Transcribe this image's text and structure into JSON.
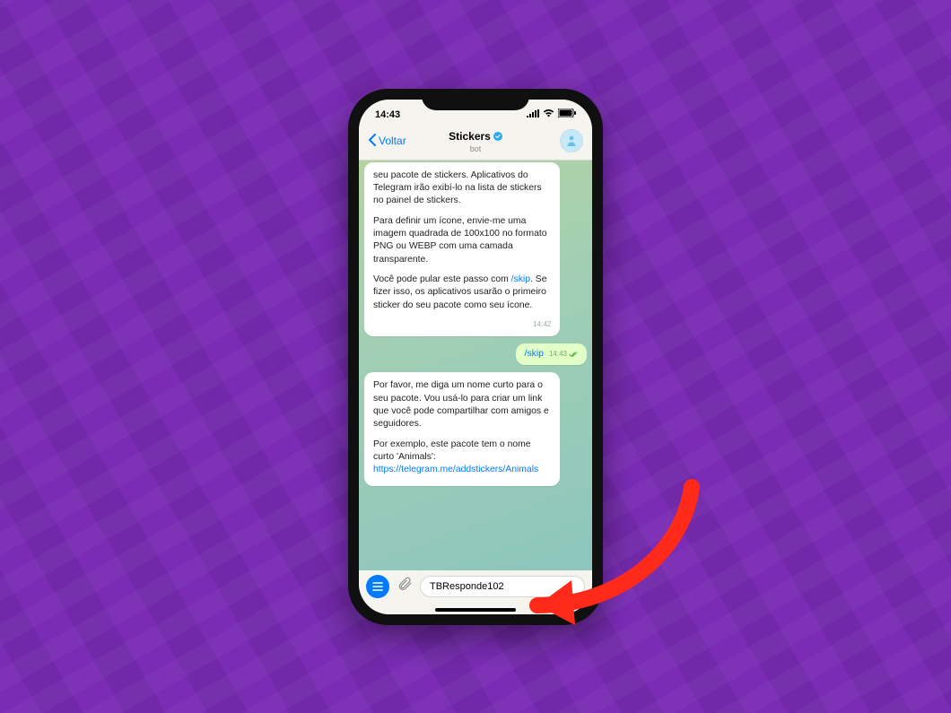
{
  "status": {
    "time": "14:43"
  },
  "nav": {
    "back": "Voltar",
    "title": "Stickers",
    "subtitle": "bot"
  },
  "messages": {
    "m1_p1_a": "seu pacote de stickers. Aplicativos do Telegram irão exibí-lo na lista de stickers no painel de stickers.",
    "m1_p2": "Para definir um ícone, envie-me uma imagem quadrada de 100x100 no formato PNG ou WEBP com uma camada transparente.",
    "m1_p3_a": "Você pode pular este passo com ",
    "m1_p3_link": "/skip",
    "m1_p3_b": ". Se fizer isso, os aplicativos usarão o primeiro sticker do seu pacote como seu ícone.",
    "m1_time": "14:42",
    "m2_text": "/skip",
    "m2_time": "14:43",
    "m3_p1": "Por favor, me diga um nome curto para o seu pacote. Vou usá-lo para criar um link que você pode compartilhar com amigos e seguidores.",
    "m3_p2_a": "Por exemplo, este pacote tem o nome curto 'Animals':",
    "m3_link": "https://telegram.me/addstickers/Animals"
  },
  "input": {
    "value": "TBResponde102"
  }
}
